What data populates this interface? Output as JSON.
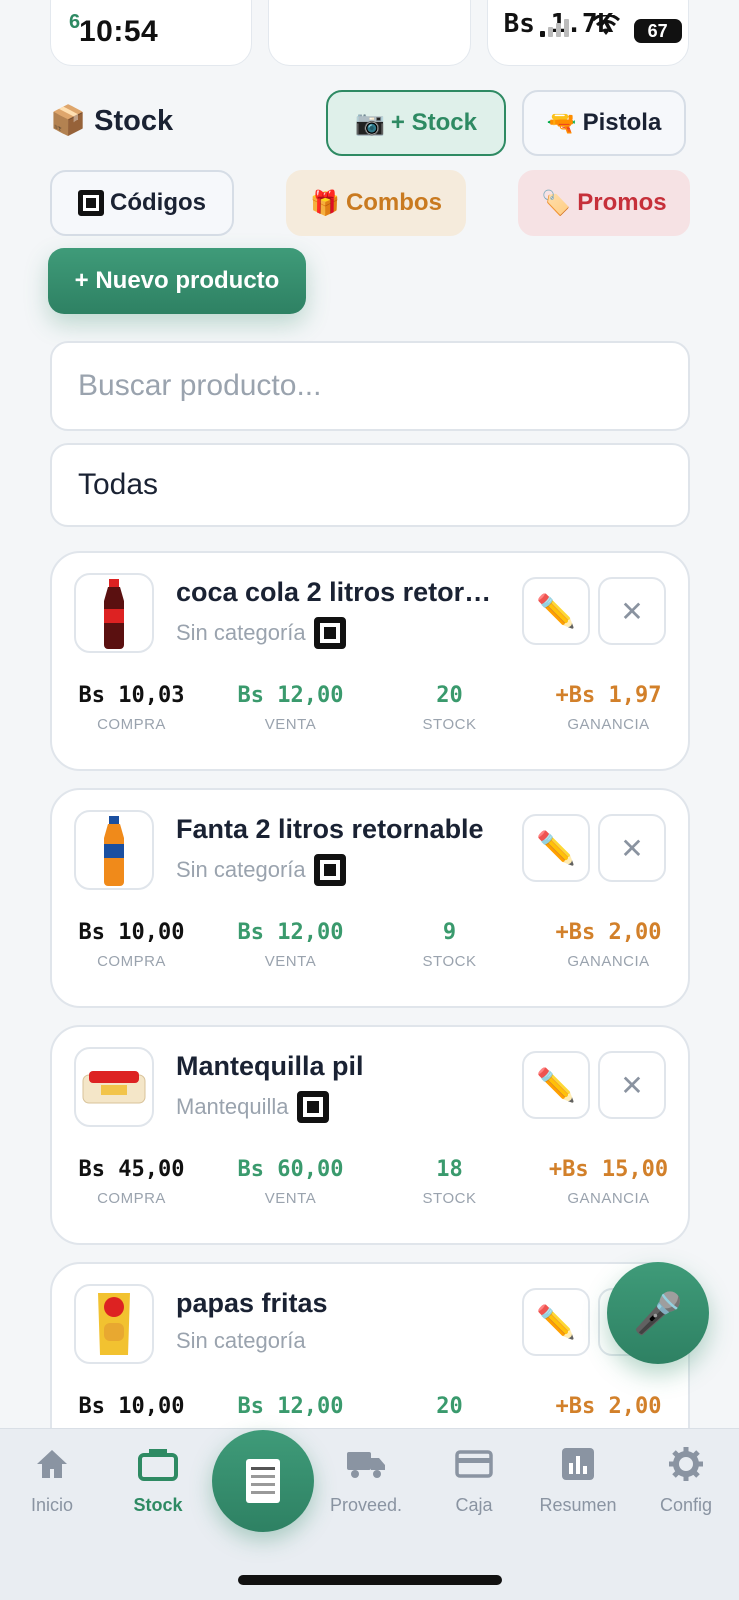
{
  "status": {
    "mini": "6",
    "time": "10:54",
    "balance": "Bs 1.7K",
    "battery": "67"
  },
  "header": {
    "title": "Stock",
    "title_icon": "package-icon",
    "stock_button": "+ Stock",
    "pistola_button": "Pistola",
    "codigos_button": "Códigos",
    "combos_button": "Combos",
    "promos_button": "Promos",
    "new_product_button": "+ Nuevo producto"
  },
  "search": {
    "placeholder": "Buscar producto..."
  },
  "filter": {
    "selected": "Todas"
  },
  "labels": {
    "buy": "COMPRA",
    "sell": "VENTA",
    "stock": "STOCK",
    "gain": "GANANCIA"
  },
  "products": [
    {
      "name": "coca cola 2 litros retorn...",
      "category": "Sin categoría",
      "buy": "Bs 10,03",
      "sell": "Bs 12,00",
      "stock": "20",
      "gain": "+Bs 1,97"
    },
    {
      "name": "Fanta 2 litros retornable",
      "category": "Sin categoría",
      "buy": "Bs 10,00",
      "sell": "Bs 12,00",
      "stock": "9",
      "gain": "+Bs 2,00"
    },
    {
      "name": "Mantequilla pil",
      "category": "Mantequilla",
      "buy": "Bs 45,00",
      "sell": "Bs 60,00",
      "stock": "18",
      "gain": "+Bs 15,00"
    },
    {
      "name": "papas fritas",
      "category": "Sin categoría",
      "buy": "Bs 10,00",
      "sell": "Bs 12,00",
      "stock": "20",
      "gain": "+Bs 2,00"
    }
  ],
  "nav": {
    "inicio": "Inicio",
    "stock": "Stock",
    "proveed": "Proveed.",
    "caja": "Caja",
    "resumen": "Resumen",
    "config": "Config"
  },
  "colors": {
    "accent": "#2e8a63",
    "gain": "#d2802a",
    "promo": "#c6303a",
    "combo": "#c97a20"
  }
}
